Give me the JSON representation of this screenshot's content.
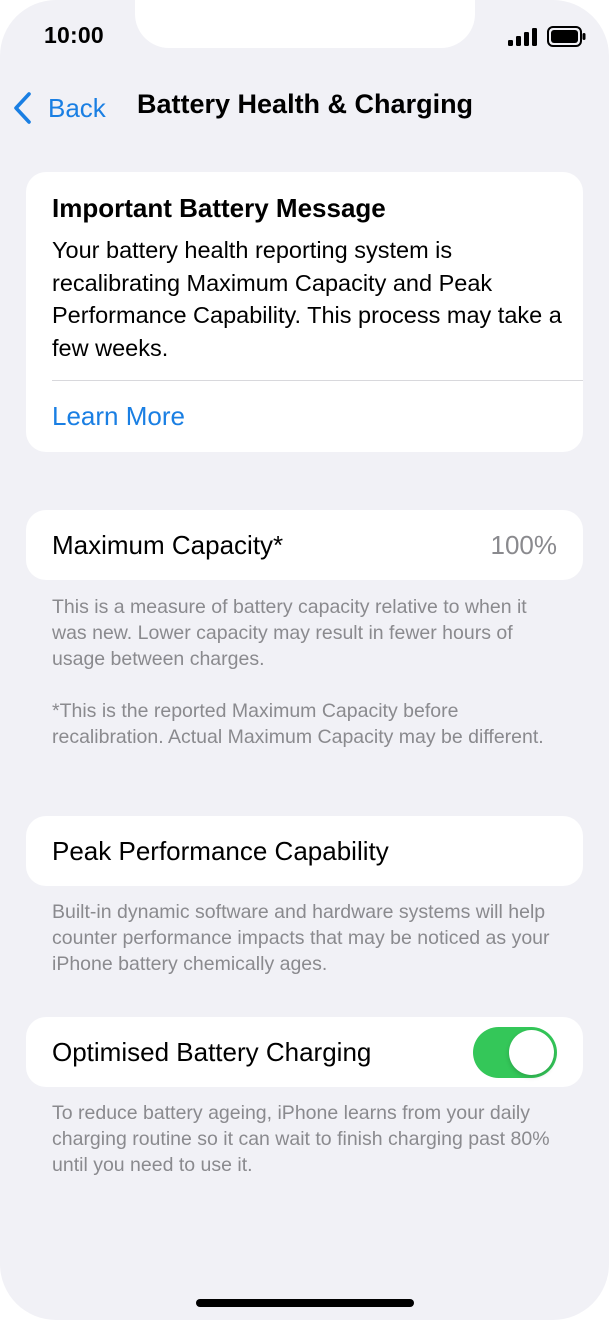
{
  "status_bar": {
    "time": "10:00",
    "signal_icon": "cellular-signal-icon",
    "battery_icon": "battery-full-icon"
  },
  "nav": {
    "back_label": "Back",
    "back_icon": "chevron-left-icon",
    "title": "Battery Health & Charging"
  },
  "message": {
    "title": "Important Battery Message",
    "body": "Your battery health reporting system is recalibrating Maximum Capacity and Peak Performance Capability. This process may take a few weeks.",
    "link": "Learn More"
  },
  "max_capacity": {
    "label": "Maximum Capacity*",
    "value": "100%",
    "note1": "This is a measure of battery capacity relative to when it was new. Lower capacity may result in fewer hours of usage between charges.",
    "note2": "*This is the reported Maximum Capacity before recalibration. Actual Maximum Capacity may be different."
  },
  "peak_performance": {
    "label": "Peak Performance Capability",
    "note": "Built-in dynamic software and hardware systems will help counter performance impacts that may be noticed as your iPhone battery chemically ages."
  },
  "optimised_charging": {
    "label": "Optimised Battery Charging",
    "enabled": true,
    "note": "To reduce battery ageing, iPhone learns from your daily charging routine so it can wait to finish charging past 80% until you need to use it."
  },
  "colors": {
    "accent": "#1a7fe3",
    "toggle_on": "#34c759",
    "background": "#f1f1f6",
    "secondary_text": "#8a8a8e"
  }
}
